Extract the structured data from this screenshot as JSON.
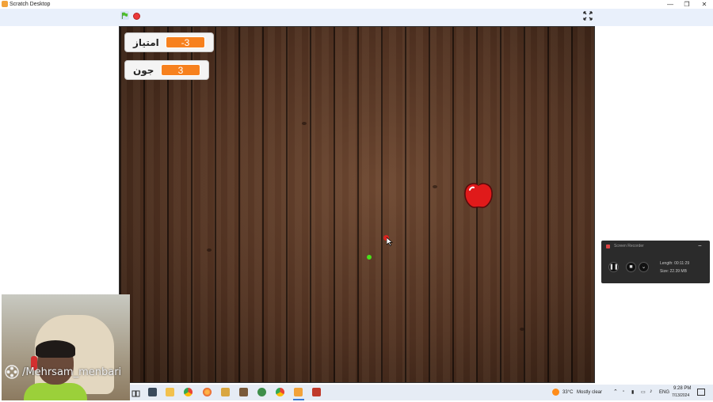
{
  "window": {
    "title": "Scratch Desktop",
    "controls": {
      "minimize": "—",
      "maximize": "❐",
      "close": "✕"
    }
  },
  "toolbar": {
    "green_flag_icon": "green-flag-icon",
    "stop_icon": "stop-icon",
    "fullscreen_icon": "fullscreen-icon"
  },
  "stage": {
    "monitors": [
      {
        "label": "امتیاز",
        "value": "-3"
      },
      {
        "label": "جون",
        "value": "3"
      }
    ],
    "sprites": [
      "apple",
      "green-dot",
      "red-dot"
    ]
  },
  "webcam": {
    "watermark": "/Mehrsam_menbari"
  },
  "recorder": {
    "title": "Screen Recorder",
    "length": "Length: 00:11:29",
    "size": "Size: 22.39 MB",
    "buttons": [
      "pause",
      "stop",
      "more"
    ]
  },
  "taskbar": {
    "weather_temp": "33°C",
    "weather_text": "Mostly clear",
    "language": "ENG",
    "time": "9:28 PM",
    "date": "7/13/2024"
  },
  "colors": {
    "monitor_value": "#f7811e",
    "stop": "#ec3a3a",
    "toolbar": "#e9f0fb"
  }
}
